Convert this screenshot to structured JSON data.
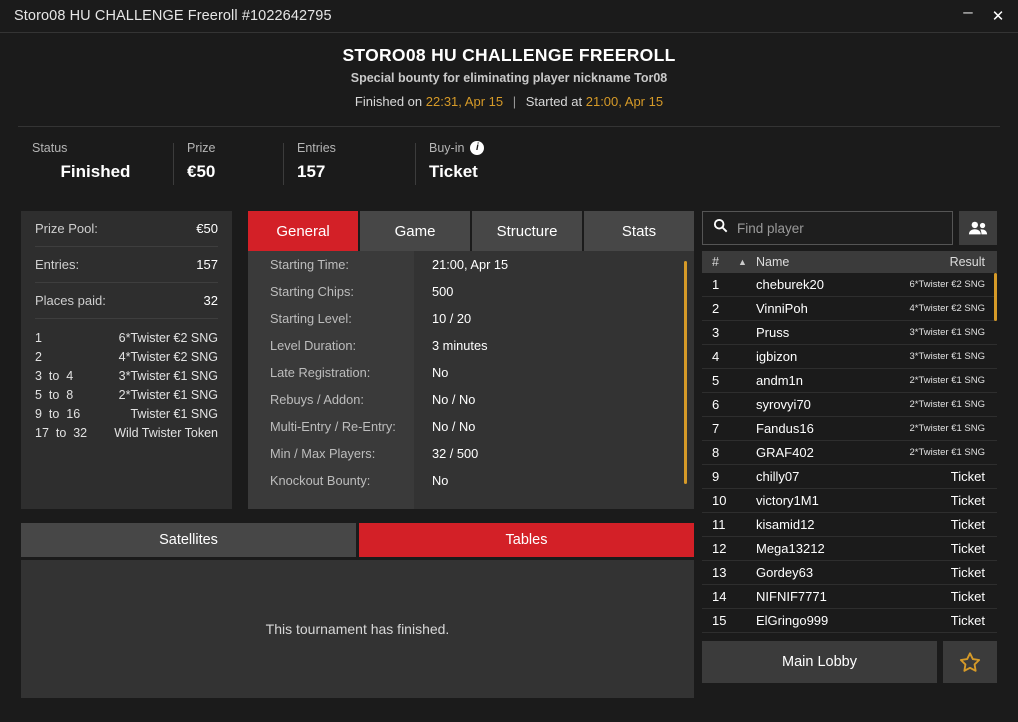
{
  "window": {
    "title": "Storo08 HU CHALLENGE Freeroll #1022642795",
    "minimize_label": "–",
    "close_label": "✕"
  },
  "header": {
    "title": "STORO08 HU CHALLENGE FREEROLL",
    "subtitle": "Special bounty for eliminating player nickname Tor08",
    "finished_label": "Finished on",
    "finished_value": "22:31, Apr 15",
    "separator": "|",
    "started_label": "Started at",
    "started_value": "21:00, Apr 15",
    "accent_gold": "#d69a28"
  },
  "stats": {
    "status": {
      "label": "Status",
      "value": "Finished"
    },
    "prize": {
      "label": "Prize",
      "value": "€50"
    },
    "entries": {
      "label": "Entries",
      "value": "157"
    },
    "buyin": {
      "label": "Buy-in",
      "value": "Ticket",
      "info_glyph": "i"
    }
  },
  "prize_panel": {
    "prize_pool": {
      "label": "Prize Pool:",
      "value": "€50"
    },
    "entries": {
      "label": "Entries:",
      "value": "157"
    },
    "places_paid": {
      "label": "Places paid:",
      "value": "32"
    },
    "payouts": [
      {
        "rank": "1",
        "prize": "6*Twister €2 SNG"
      },
      {
        "rank": "2",
        "prize": "4*Twister €2 SNG"
      },
      {
        "rank": "3  to  4",
        "prize": "3*Twister €1 SNG"
      },
      {
        "rank": "5  to  8",
        "prize": "2*Twister €1 SNG"
      },
      {
        "rank": "9  to  16",
        "prize": "Twister €1 SNG"
      },
      {
        "rank": "17  to  32",
        "prize": "Wild Twister Token"
      }
    ]
  },
  "tabs": {
    "items": [
      {
        "label": "General",
        "active": true
      },
      {
        "label": "Game",
        "active": false
      },
      {
        "label": "Structure",
        "active": false
      },
      {
        "label": "Stats",
        "active": false
      }
    ],
    "active_color": "#d32027"
  },
  "general": {
    "rows": [
      {
        "label": "Starting Time:",
        "value": "21:00, Apr 15"
      },
      {
        "label": "Starting Chips:",
        "value": "500"
      },
      {
        "label": "Starting Level:",
        "value": "10 / 20"
      },
      {
        "label": "Level Duration:",
        "value": "3 minutes"
      },
      {
        "label": "Late Registration:",
        "value": "No"
      },
      {
        "label": "Rebuys / Addon:",
        "value": "No / No"
      },
      {
        "label": "Multi-Entry / Re-Entry:",
        "value": "No / No"
      },
      {
        "label": "Min / Max Players:",
        "value": "32 / 500"
      },
      {
        "label": "Knockout Bounty:",
        "value": "No"
      }
    ]
  },
  "lower_tabs": {
    "items": [
      {
        "label": "Satellites",
        "active": false
      },
      {
        "label": "Tables",
        "active": true
      }
    ],
    "message": "This tournament has finished."
  },
  "players": {
    "search_placeholder": "Find player",
    "search_value": "",
    "search_icon": "search-icon",
    "people_icon": "people-icon",
    "columns": {
      "num": "#",
      "sort": "▲",
      "name": "Name",
      "result": "Result"
    },
    "rows": [
      {
        "num": "1",
        "name": "cheburek20",
        "result": "6*Twister €2 SNG",
        "small": true
      },
      {
        "num": "2",
        "name": "VinniPoh",
        "result": "4*Twister €2 SNG",
        "small": true
      },
      {
        "num": "3",
        "name": "Pruss",
        "result": "3*Twister €1 SNG",
        "small": true
      },
      {
        "num": "4",
        "name": "igbizon",
        "result": "3*Twister €1 SNG",
        "small": true
      },
      {
        "num": "5",
        "name": "andm1n",
        "result": "2*Twister €1 SNG",
        "small": true
      },
      {
        "num": "6",
        "name": "syrovyi70",
        "result": "2*Twister €1 SNG",
        "small": true
      },
      {
        "num": "7",
        "name": "Fandus16",
        "result": "2*Twister €1 SNG",
        "small": true
      },
      {
        "num": "8",
        "name": "GRAF402",
        "result": "2*Twister €1 SNG",
        "small": true
      },
      {
        "num": "9",
        "name": "chilly07",
        "result": "Ticket",
        "small": false
      },
      {
        "num": "10",
        "name": "victory1M1",
        "result": "Ticket",
        "small": false
      },
      {
        "num": "11",
        "name": "kisamid12",
        "result": "Ticket",
        "small": false
      },
      {
        "num": "12",
        "name": "Mega13212",
        "result": "Ticket",
        "small": false
      },
      {
        "num": "13",
        "name": "Gordey63",
        "result": "Ticket",
        "small": false
      },
      {
        "num": "14",
        "name": "NIFNIF7771",
        "result": "Ticket",
        "small": false
      },
      {
        "num": "15",
        "name": "ElGringo999",
        "result": "Ticket",
        "small": false
      }
    ]
  },
  "footer": {
    "main_lobby": "Main Lobby",
    "favorite_icon": "star-icon"
  }
}
